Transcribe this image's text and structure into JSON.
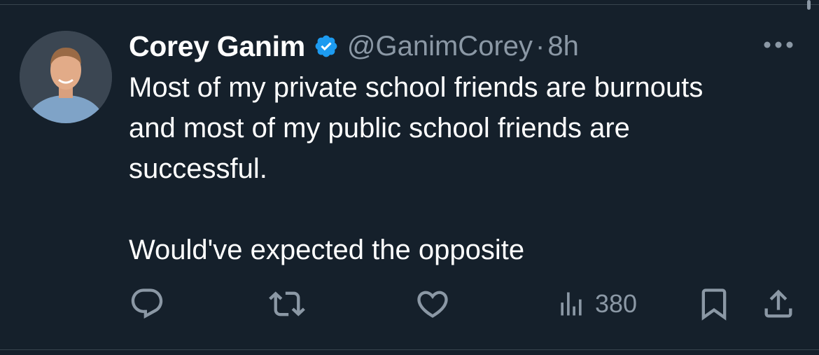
{
  "tweet": {
    "author": {
      "display_name": "Corey Ganim",
      "handle": "@GanimCorey",
      "verified": true
    },
    "separator": "·",
    "time": "8h",
    "text_lines": [
      "Most of my private school friends are burnouts",
      "and most of my public school friends are",
      "successful.",
      "",
      "Would've expected the opposite"
    ],
    "actions": {
      "reply_icon": "reply-icon",
      "retweet_icon": "retweet-icon",
      "like_icon": "like-icon",
      "views_icon": "views-icon",
      "views_count": "380",
      "bookmark_icon": "bookmark-icon",
      "share_icon": "share-icon",
      "more_icon": "more-options-icon"
    }
  },
  "colors": {
    "background": "#15202b",
    "text_primary": "#ffffff",
    "text_secondary": "#8b98a5",
    "verified_blue": "#1d9bf0",
    "divider": "#38444d"
  }
}
